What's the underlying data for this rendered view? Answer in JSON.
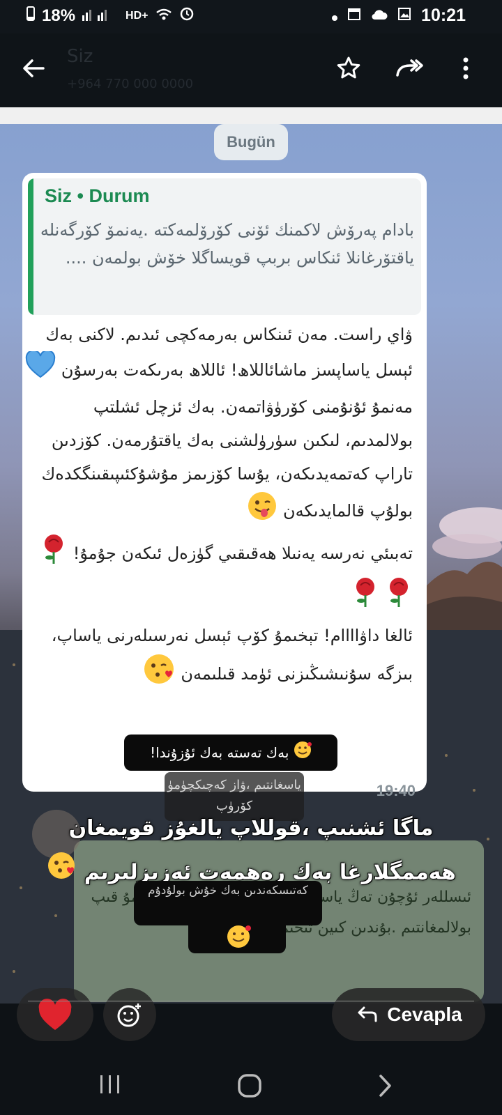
{
  "status_bar": {
    "battery": "18%",
    "network": "HD+",
    "time": "10:21"
  },
  "app_bar": {
    "ghost_title": "Siz",
    "ghost_subtitle": "+964 770 000 0000"
  },
  "chat": {
    "date_label": "Bugün",
    "quoted": {
      "header": "Siz • Durum",
      "text": "بادام پەرۆش لاکمنك ئۆنى كۆرۆلمەكتە .يەنمۆ كۆرگەنلە ياقتۆرغانلا ئنكاس بربپ قويساگلا خۆش بولمەن ...."
    },
    "message_paragraphs": [
      "ۋاي راست. مەن ئىنكاس بەرمەكچى ئىدىم. لاكنى بەك ئېسل ياساپسز ماشائاللاھ! ئاللاھ بەرىكەت بەرسۇن",
      "مەنمۇ ئۇنۇمنى كۆرۈۋاتمەن. بەك ئزچل ئشلتپ بولالمدىم، لىكىن سۈرۈلشنى بەك ياقتۇرمەن. كۆزدىن تاراپ كەتمەيدىكەن، يۇسا كۆزىمز مۇشۇكئىپىقىنگكدەك بولۇپ قالمايدىكەن",
      "تەبىئي نەرسە يەنىلا ھەقىقىي گۈزەل ئىكەن جۇمۇ!",
      "ئالغا داۋاااام! تېخىمۇ كۆپ ئېسل نەرسىلەرنى ياساپ، بىزگە سۇنىشىڭىزنى ئۈمد قىلىمەن"
    ],
    "time": "19:40"
  },
  "overlay": {
    "sticker_top": "بەك تەستە بەك ئۇزۇندا!",
    "ghost_reply": "ياسغانتىم ،ۋاز كەچىكچۈمۈ كۆرۈپ",
    "ghost_bubble_text": "ئىسللەر ئۇچۇن تەڭ ياسشىم بولغانكن تازا قويدىكدەكمۇ قىپ بولالمغانتىم .بۇندىن كىين تىخىمۇ",
    "caption": "ماگا ئشنىپ ،قوللاپ يالغۇز قويمغان ھەممگلارغا بەك رەھمەت ئەزىزلىرىم",
    "sticker_bottom": "كەتىسكەندىن بەك خۇش بولۇدۇم"
  },
  "actions": {
    "reply_label": "Cevapla"
  },
  "colors": {
    "accent_green": "#21a05a",
    "bubble": "#ffffff",
    "heart": "#e0242e"
  }
}
